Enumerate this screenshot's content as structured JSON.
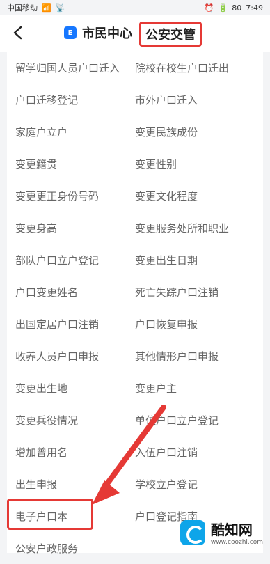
{
  "status": {
    "carrier": "中国移动",
    "time": "7:49",
    "battery": "80"
  },
  "header": {
    "back_icon": "back-arrow-icon",
    "app_icon": "form-icon",
    "title": "市民中心",
    "subtitle": "公安交管"
  },
  "list": {
    "items": [
      [
        "留学归国人员户口迁入",
        "院校在校生户口迁出"
      ],
      [
        "户口迁移登记",
        "市外户口迁入"
      ],
      [
        "家庭户立户",
        "变更民族成份"
      ],
      [
        "变更籍贯",
        "变更性别"
      ],
      [
        "变更更正身份号码",
        "变更文化程度"
      ],
      [
        "变更身高",
        "变更服务处所和职业"
      ],
      [
        "部队户口立户登记",
        "变更出生日期"
      ],
      [
        "户口变更姓名",
        "死亡失踪户口注销"
      ],
      [
        "出国定居户口注销",
        "户口恢复申报"
      ],
      [
        "收养人员户口申报",
        "其他情形户口申报"
      ],
      [
        "变更出生地",
        "变更户主"
      ],
      [
        "变更兵役情况",
        "单位户口立户登记"
      ],
      [
        "增加曾用名",
        "入伍户口注销"
      ],
      [
        "出生申报",
        "学校立户登记"
      ],
      [
        "电子户口本",
        "户口登记指南"
      ],
      [
        "公安户政服务",
        ""
      ]
    ]
  },
  "watermark": {
    "name": "酷知网",
    "url": "www.coozhi.com"
  },
  "colors": {
    "accent": "#e53935",
    "brand": "#1677ff"
  }
}
